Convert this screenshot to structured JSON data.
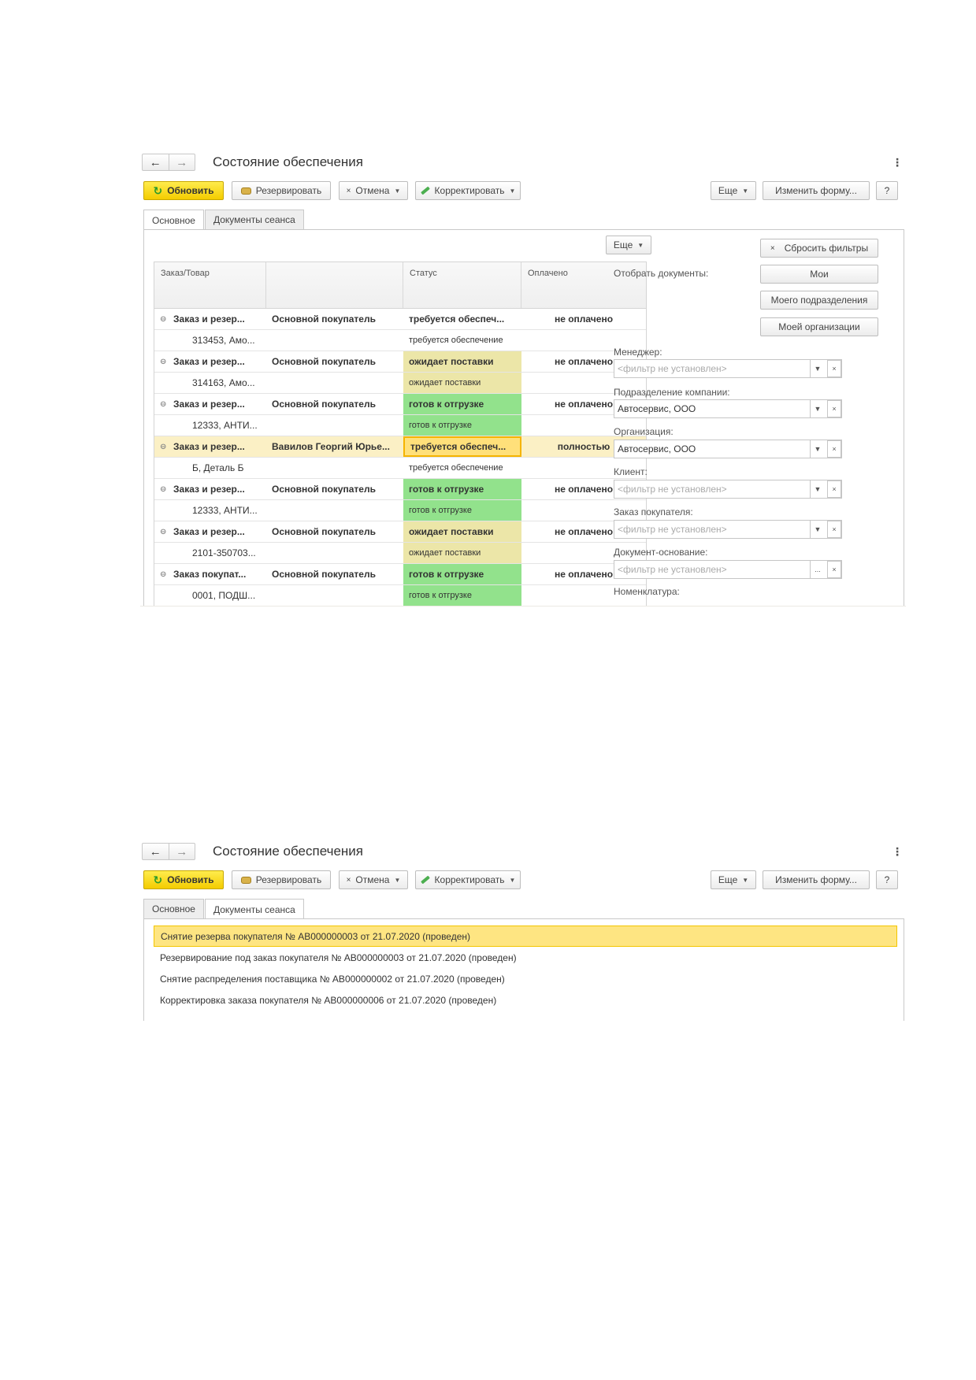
{
  "panel1": {
    "title": "Состояние обеспечения",
    "toolbar": {
      "refresh": "Обновить",
      "reserve": "Резервировать",
      "cancel": "Отмена",
      "adjust": "Корректировать",
      "more": "Еще",
      "change_form": "Изменить форму...",
      "help": "?"
    },
    "tabs": [
      "Основное",
      "Документы сеанса"
    ],
    "table_more": "Еще",
    "columns": [
      "Заказ/Товар",
      "",
      "Статус",
      "Оплачено"
    ],
    "rows": [
      {
        "c1": "Заказ и резер...",
        "c2": "Основной покупатель",
        "c3": "требуется обеспеч...",
        "c4": "не оплачено"
      },
      {
        "c1": "313453, Амо...",
        "c2": "",
        "c3": "требуется обеспечение",
        "c4": ""
      },
      {
        "c1": "Заказ и резер...",
        "c2": "Основной покупатель",
        "c3": "ожидает поставки",
        "c4": "не оплачено"
      },
      {
        "c1": "314163, Амо...",
        "c2": "",
        "c3": "ожидает поставки",
        "c4": ""
      },
      {
        "c1": "Заказ и резер...",
        "c2": "Основной покупатель",
        "c3": "готов к отгрузке",
        "c4": "не оплачено"
      },
      {
        "c1": "12333, АНТИ...",
        "c2": "",
        "c3": "готов к отгрузке",
        "c4": ""
      },
      {
        "c1": "Заказ и резер...",
        "c2": "Вавилов Георгий Юрье...",
        "c3": "требуется обеспеч...",
        "c4": "полностью"
      },
      {
        "c1": "Б, Деталь Б",
        "c2": "",
        "c3": "требуется обеспечение",
        "c4": ""
      },
      {
        "c1": "Заказ и резер...",
        "c2": "Основной покупатель",
        "c3": "готов к отгрузке",
        "c4": "не оплачено"
      },
      {
        "c1": "12333, АНТИ...",
        "c2": "",
        "c3": "готов к отгрузке",
        "c4": ""
      },
      {
        "c1": "Заказ и резер...",
        "c2": "Основной покупатель",
        "c3": "ожидает поставки",
        "c4": "не оплачено"
      },
      {
        "c1": "2101-350703...",
        "c2": "",
        "c3": "ожидает поставки",
        "c4": ""
      },
      {
        "c1": "Заказ покупат...",
        "c2": "Основной покупатель",
        "c3": "готов к отгрузке",
        "c4": "не оплачено"
      },
      {
        "c1": "0001, ПОДШ...",
        "c2": "",
        "c3": "готов к отгрузке",
        "c4": ""
      }
    ],
    "filters": {
      "reset": "Сбросить фильтры",
      "show_docs_label": "Отобрать документы:",
      "mine": "Мои",
      "my_department": "Моего подразделения",
      "my_organization": "Моей организации",
      "manager_label": "Менеджер:",
      "manager_value": "<фильтр не установлен>",
      "department_label": "Подразделение компании:",
      "department_value": "Автосервис, ООО",
      "organization_label": "Организация:",
      "organization_value": "Автосервис, ООО",
      "client_label": "Клиент:",
      "client_value": "<фильтр не установлен>",
      "order_label": "Заказ покупателя:",
      "order_value": "<фильтр не установлен>",
      "basis_label": "Документ-основание:",
      "basis_value": "<фильтр не установлен>",
      "nomenclature_label": "Номенклатура:"
    }
  },
  "panel2": {
    "title": "Состояние обеспечения",
    "toolbar": {
      "refresh": "Обновить",
      "reserve": "Резервировать",
      "cancel": "Отмена",
      "adjust": "Корректировать",
      "more": "Еще",
      "change_form": "Изменить форму...",
      "help": "?"
    },
    "tabs": [
      "Основное",
      "Документы сеанса"
    ],
    "documents": [
      "Снятие резерва покупателя № АВ000000003 от 21.07.2020 (проведен)",
      "Резервирование под заказ покупателя № АВ000000003 от 21.07.2020 (проведен)",
      "Снятие распределения поставщика № АВ000000002 от 21.07.2020 (проведен)",
      "Корректировка заказа покупателя № АВ000000006 от 21.07.2020 (проведен)"
    ]
  },
  "colors": {
    "accent_yellow": "#f4cc00",
    "status_ready": "#92e28c",
    "status_waiting": "#ece6a8",
    "selected_row": "#fbf0c5"
  }
}
